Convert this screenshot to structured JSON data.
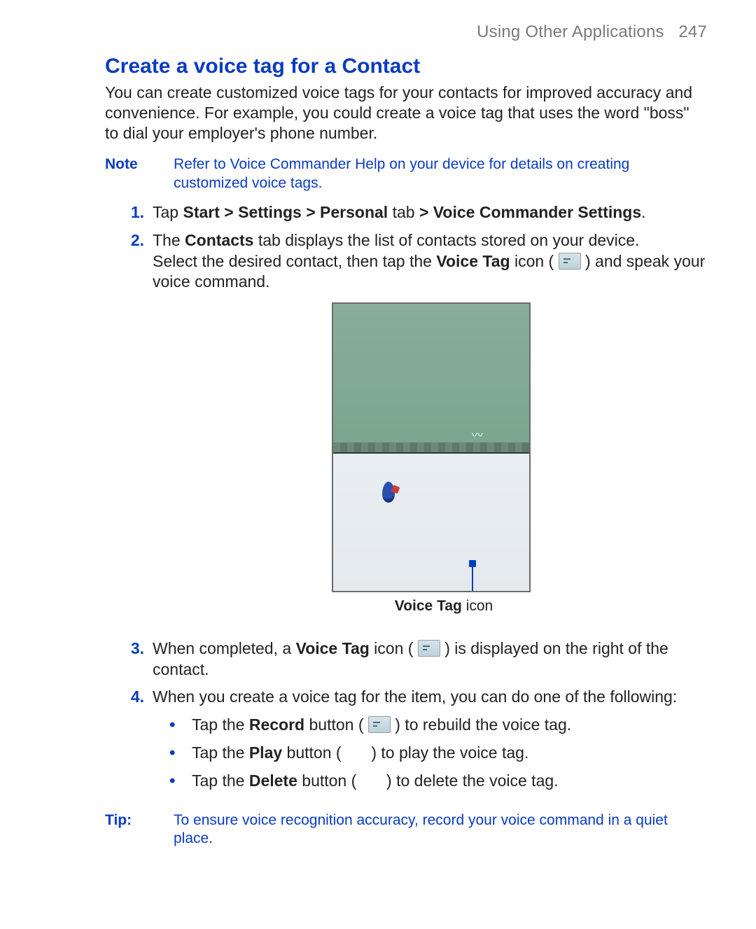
{
  "runningHead": {
    "section": "Using Other Applications",
    "page": "247"
  },
  "title": "Create a voice tag for a Contact",
  "intro": "You can create customized voice tags for your contacts for improved accuracy and convenience.  For  example, you could create a voice tag that uses the word \"boss\" to dial your employer's phone number.",
  "note": {
    "label": "Note",
    "body": "Refer to  Voice Commander Help on your device for details on creating customized voice tags."
  },
  "steps": {
    "s1": {
      "num": "1.",
      "prefix": "Tap ",
      "bold": "Start > Settings > Personal",
      "mid": " tab ",
      "bold2": "> Voice Commander Settings",
      "suffix": "."
    },
    "s2": {
      "num": "2.",
      "a": "The ",
      "b": "Contacts",
      "c": " tab displays the list of contacts stored on your device.",
      "d": "Select the desired contact, then tap the ",
      "e": "Voice Tag",
      "f": " icon ( ",
      "g": " ) and speak your voice command."
    },
    "s3": {
      "num": "3.",
      "a": "When completed, a ",
      "b": "Voice Tag",
      "c": " icon ( ",
      "d": " ) is displayed on the right of the contact."
    },
    "s4": {
      "num": "4.",
      "a": "When you create a voice tag for the item, you can do one of the following:",
      "sub": {
        "r": {
          "a": "Tap the ",
          "b": "Record",
          "c": " button ( ",
          "d": " ) to rebuild the voice tag."
        },
        "p": {
          "a": "Tap the ",
          "b": "Play",
          "c": " button ( ",
          "d": " ) to play the voice tag."
        },
        "x": {
          "a": "Tap the ",
          "b": "Delete",
          "c": " button ( ",
          "d": " ) to delete the voice tag."
        }
      }
    }
  },
  "figureCaption": {
    "bold": "Voice Tag",
    "rest": " icon"
  },
  "tip": {
    "label": "Tip:",
    "body": "To ensure voice recognition accuracy, record your voice command in a quiet place."
  },
  "bulletGlyph": "•"
}
